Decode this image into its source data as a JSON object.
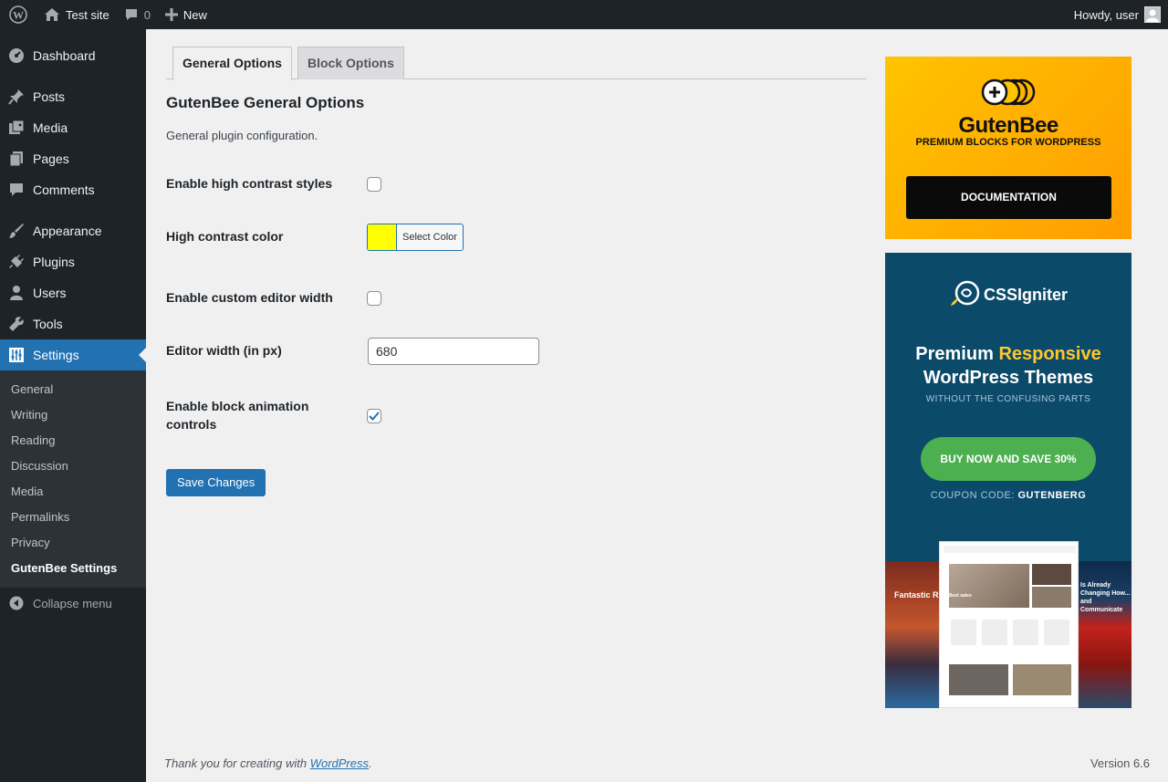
{
  "adminbar": {
    "site_name": "Test site",
    "comments_count": "0",
    "new_label": "New",
    "greeting": "Howdy, user"
  },
  "sidebar": {
    "items": [
      {
        "label": "Dashboard",
        "icon": "dashboard-icon"
      },
      {
        "label": "Posts",
        "icon": "pin-icon"
      },
      {
        "label": "Media",
        "icon": "media-icon"
      },
      {
        "label": "Pages",
        "icon": "pages-icon"
      },
      {
        "label": "Comments",
        "icon": "comment-icon"
      },
      {
        "label": "Appearance",
        "icon": "brush-icon"
      },
      {
        "label": "Plugins",
        "icon": "plug-icon"
      },
      {
        "label": "Users",
        "icon": "user-icon"
      },
      {
        "label": "Tools",
        "icon": "wrench-icon"
      },
      {
        "label": "Settings",
        "icon": "settings-icon"
      }
    ],
    "submenu": [
      "General",
      "Writing",
      "Reading",
      "Discussion",
      "Media",
      "Permalinks",
      "Privacy",
      "GutenBee Settings"
    ],
    "collapse_label": "Collapse menu"
  },
  "tabs": [
    "General Options",
    "Block Options"
  ],
  "page": {
    "title": "GutenBee General Options",
    "description": "General plugin configuration."
  },
  "fields": {
    "high_contrast_label": "Enable high contrast styles",
    "high_contrast_checked": false,
    "contrast_color_label": "High contrast color",
    "contrast_color_value": "#ffff00",
    "select_color_label": "Select Color",
    "custom_width_label": "Enable custom editor width",
    "custom_width_checked": false,
    "editor_width_label": "Editor width (in px)",
    "editor_width_value": "680",
    "animation_label": "Enable block animation controls",
    "animation_checked": true
  },
  "save_label": "Save Changes",
  "promo_gutenbee": {
    "title": "GutenBee",
    "subtitle": "PREMIUM BLOCKS FOR WORDPRESS",
    "button": "DOCUMENTATION"
  },
  "promo_cssigniter": {
    "brand": "CSSIgniter",
    "headline_plain": "Premium ",
    "headline_highlight": "Responsive",
    "headline_line2": "WordPress Themes",
    "tagline": "WITHOUT THE CONFUSING PARTS",
    "button": "BUY NOW AND SAVE 30%",
    "coupon_prefix": "COUPON CODE: ",
    "coupon_code": "GUTENBERG",
    "shot_left_text": "Fantastic Rai",
    "shot_right_text": "Is Already Changing How... and Communicate",
    "shot_center_text": "Best sales"
  },
  "footer": {
    "thanks_prefix": "Thank you for creating with ",
    "thanks_link": "WordPress",
    "thanks_suffix": ".",
    "version": "Version 6.6"
  },
  "colors": {
    "accent": "#2271b1",
    "adminbar_bg": "#1d2327",
    "promo_yellow": "#ffb800",
    "promo_teal": "#0c4a6a",
    "promo_green": "#4caf50"
  }
}
